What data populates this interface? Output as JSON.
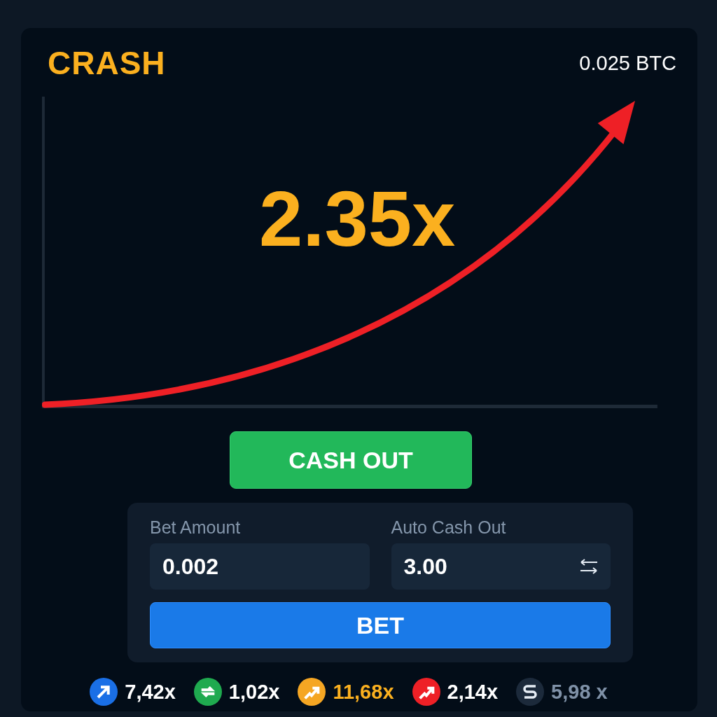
{
  "header": {
    "title": "CRASH",
    "balance": "0.025 BTC"
  },
  "game": {
    "multiplier": "2.35x"
  },
  "cash_out_button": "CASH OUT",
  "bet_panel": {
    "bet_amount": {
      "label": "Bet Amount",
      "value": "0.002"
    },
    "auto_cash_out": {
      "label": "Auto Cash Out",
      "value": "3.00"
    },
    "bet_button": "BET"
  },
  "history": [
    {
      "kind": "arrow",
      "color": "#1a6fe6",
      "value": "7,42x",
      "highlighted": false,
      "dimmed": false
    },
    {
      "kind": "swap",
      "color": "#1faa4f",
      "value": "1,02x",
      "highlighted": false,
      "dimmed": false
    },
    {
      "kind": "rise",
      "color": "#f5a623",
      "value": "11,68x",
      "highlighted": true,
      "dimmed": false
    },
    {
      "kind": "rise",
      "color": "#ee2026",
      "value": "2,14x",
      "highlighted": false,
      "dimmed": false
    },
    {
      "kind": "letter",
      "color": "#1c2a3b",
      "value": "5,98 x",
      "highlighted": false,
      "dimmed": true
    }
  ]
}
